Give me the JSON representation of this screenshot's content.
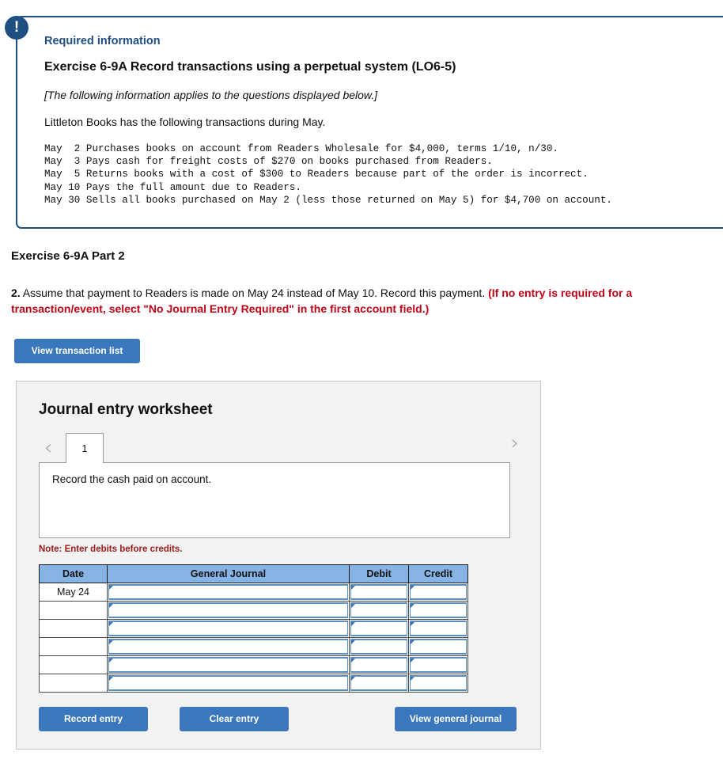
{
  "callout": {
    "badge_icon": "exclamation-icon",
    "required_label": "Required information",
    "exercise_title": "Exercise 6-9A Record transactions using a perpetual system (LO6-5)",
    "applies_note": "[The following information applies to the questions displayed below.]",
    "lead_in": "Littleton Books has the following transactions during May.",
    "transactions_text": "May  2 Purchases books on account from Readers Wholesale for $4,000, terms 1/10, n/30.\nMay  3 Pays cash for freight costs of $270 on books purchased from Readers.\nMay  5 Returns books with a cost of $300 to Readers because part of the order is incorrect.\nMay 10 Pays the full amount due to Readers.\nMay 30 Sells all books purchased on May 2 (less those returned on May 5) for $4,700 on account.",
    "transactions": [
      {
        "date": "May  2",
        "text": "Purchases books on account from Readers Wholesale for $4,000, terms 1/10, n/30."
      },
      {
        "date": "May  3",
        "text": "Pays cash for freight costs of $270 on books purchased from Readers."
      },
      {
        "date": "May  5",
        "text": "Returns books with a cost of $300 to Readers because part of the order is incorrect."
      },
      {
        "date": "May 10",
        "text": "Pays the full amount due to Readers."
      },
      {
        "date": "May 30",
        "text": "Sells all books purchased on May 2 (less those returned on May 5) for $4,700 on account."
      }
    ]
  },
  "part": {
    "heading": "Exercise 6-9A Part 2",
    "question_number": "2.",
    "question_black": " Assume that payment to Readers is made on May 24 instead of May 10. Record this payment. ",
    "question_red": "(If no entry is required for a transaction/event, select \"No Journal Entry Required\" in the first account field.)"
  },
  "toolbar": {
    "view_transaction_list_label": "View transaction list"
  },
  "worksheet": {
    "title": "Journal entry worksheet",
    "prev_arrow": "‹",
    "next_arrow": "›",
    "tabs": [
      {
        "label": "1",
        "selected": true
      }
    ],
    "panel_text": "Record the cash paid on account.",
    "note": "Note: Enter debits before credits.",
    "table": {
      "headers": [
        "Date",
        "General Journal",
        "Debit",
        "Credit"
      ],
      "rows": [
        {
          "date": "May 24",
          "general_journal": "",
          "debit": "",
          "credit": ""
        },
        {
          "date": "",
          "general_journal": "",
          "debit": "",
          "credit": ""
        },
        {
          "date": "",
          "general_journal": "",
          "debit": "",
          "credit": ""
        },
        {
          "date": "",
          "general_journal": "",
          "debit": "",
          "credit": ""
        },
        {
          "date": "",
          "general_journal": "",
          "debit": "",
          "credit": ""
        },
        {
          "date": "",
          "general_journal": "",
          "debit": "",
          "credit": ""
        }
      ]
    },
    "actions": {
      "record_entry_label": "Record entry",
      "clear_entry_label": "Clear entry",
      "view_general_journal_label": "View general journal"
    }
  },
  "colors": {
    "callout_border": "#1f4e82",
    "callout_accent": "#1f4e82",
    "button_blue": "#3b77bc",
    "table_header_blue": "#85b4e5",
    "field_blue": "#5b8ec4",
    "red_text": "#c00418",
    "note_red": "#9a1b1b",
    "panel_gray": "#f2f2f2"
  }
}
